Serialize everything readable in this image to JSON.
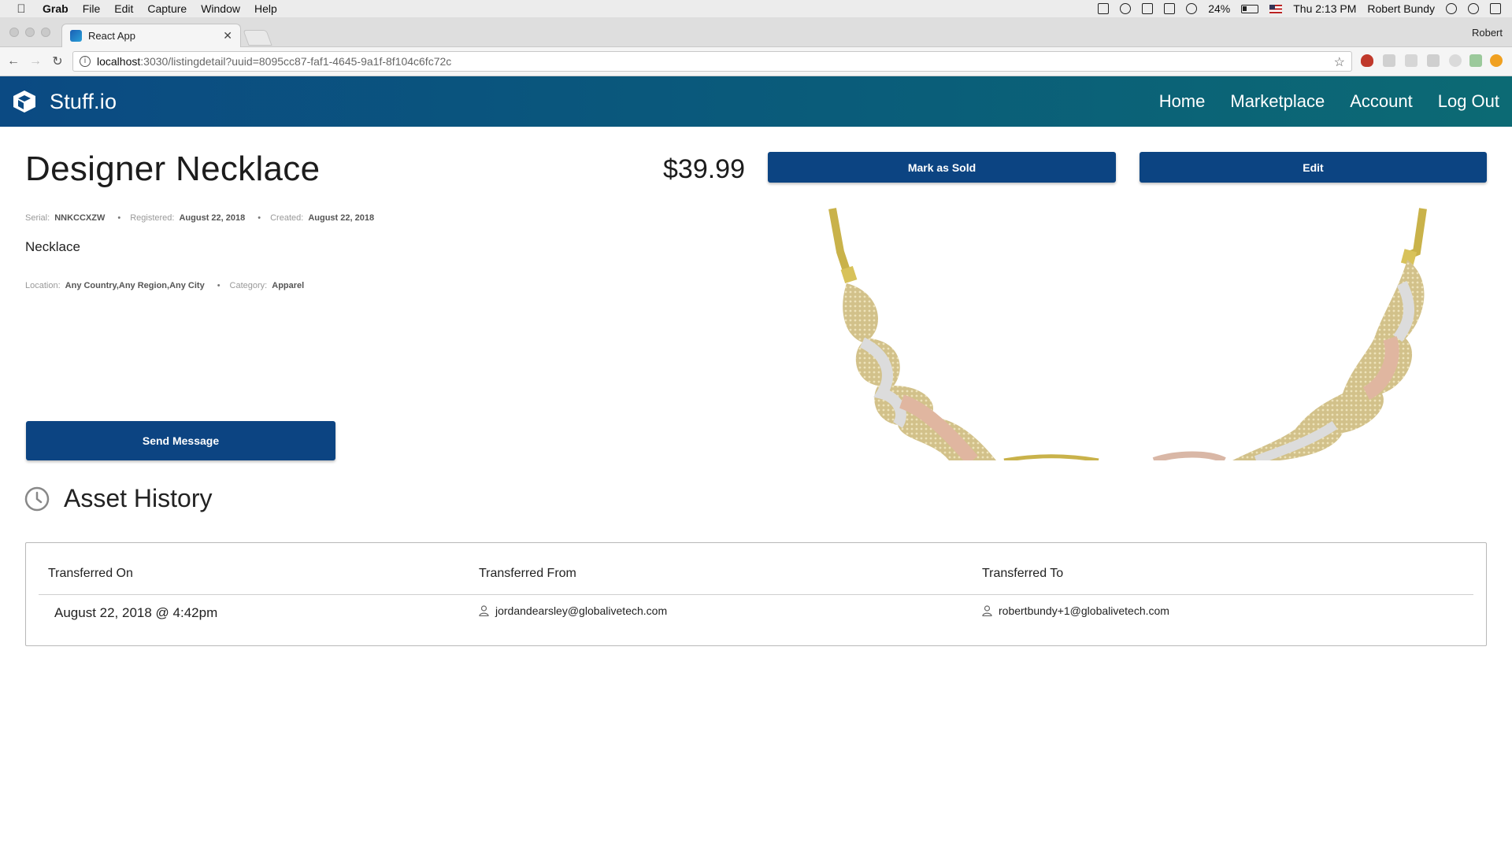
{
  "os_menubar": {
    "app_name": "Grab",
    "menus": [
      "File",
      "Edit",
      "Capture",
      "Window",
      "Help"
    ],
    "battery": "24%",
    "clock": "Thu 2:13 PM",
    "user": "Robert Bundy"
  },
  "browser": {
    "tab_title": "React App",
    "profile": "Robert",
    "url_host": "localhost",
    "url_path": ":3030/listingdetail?uuid=8095cc87-faf1-4645-9a1f-8f104c6fc72c"
  },
  "app": {
    "brand": "Stuff.io",
    "nav": [
      "Home",
      "Marketplace",
      "Account",
      "Log Out"
    ]
  },
  "listing": {
    "title": "Designer Necklace",
    "price": "$39.99",
    "mark_sold_label": "Mark as Sold",
    "edit_label": "Edit",
    "serial_label": "Serial:",
    "serial": "NNKCCXZW",
    "registered_label": "Registered:",
    "registered": "August 22, 2018",
    "created_label": "Created:",
    "created": "August 22, 2018",
    "description": "Necklace",
    "location_label": "Location:",
    "location": "Any Country,Any Region,Any City",
    "category_label": "Category:",
    "category": "Apparel",
    "send_message_label": "Send Message"
  },
  "history": {
    "title": "Asset History",
    "headers": {
      "on": "Transferred On",
      "from": "Transferred From",
      "to": "Transferred To"
    },
    "rows": [
      {
        "on": "August 22, 2018 @ 4:42pm",
        "from": "jordandearsley@globalivetech.com",
        "to": "robertbundy+1@globalivetech.com"
      }
    ]
  },
  "colors": {
    "primary_button": "#0c4482",
    "header_gradient_start": "#0b4a83",
    "header_gradient_end": "#0c6a74"
  }
}
